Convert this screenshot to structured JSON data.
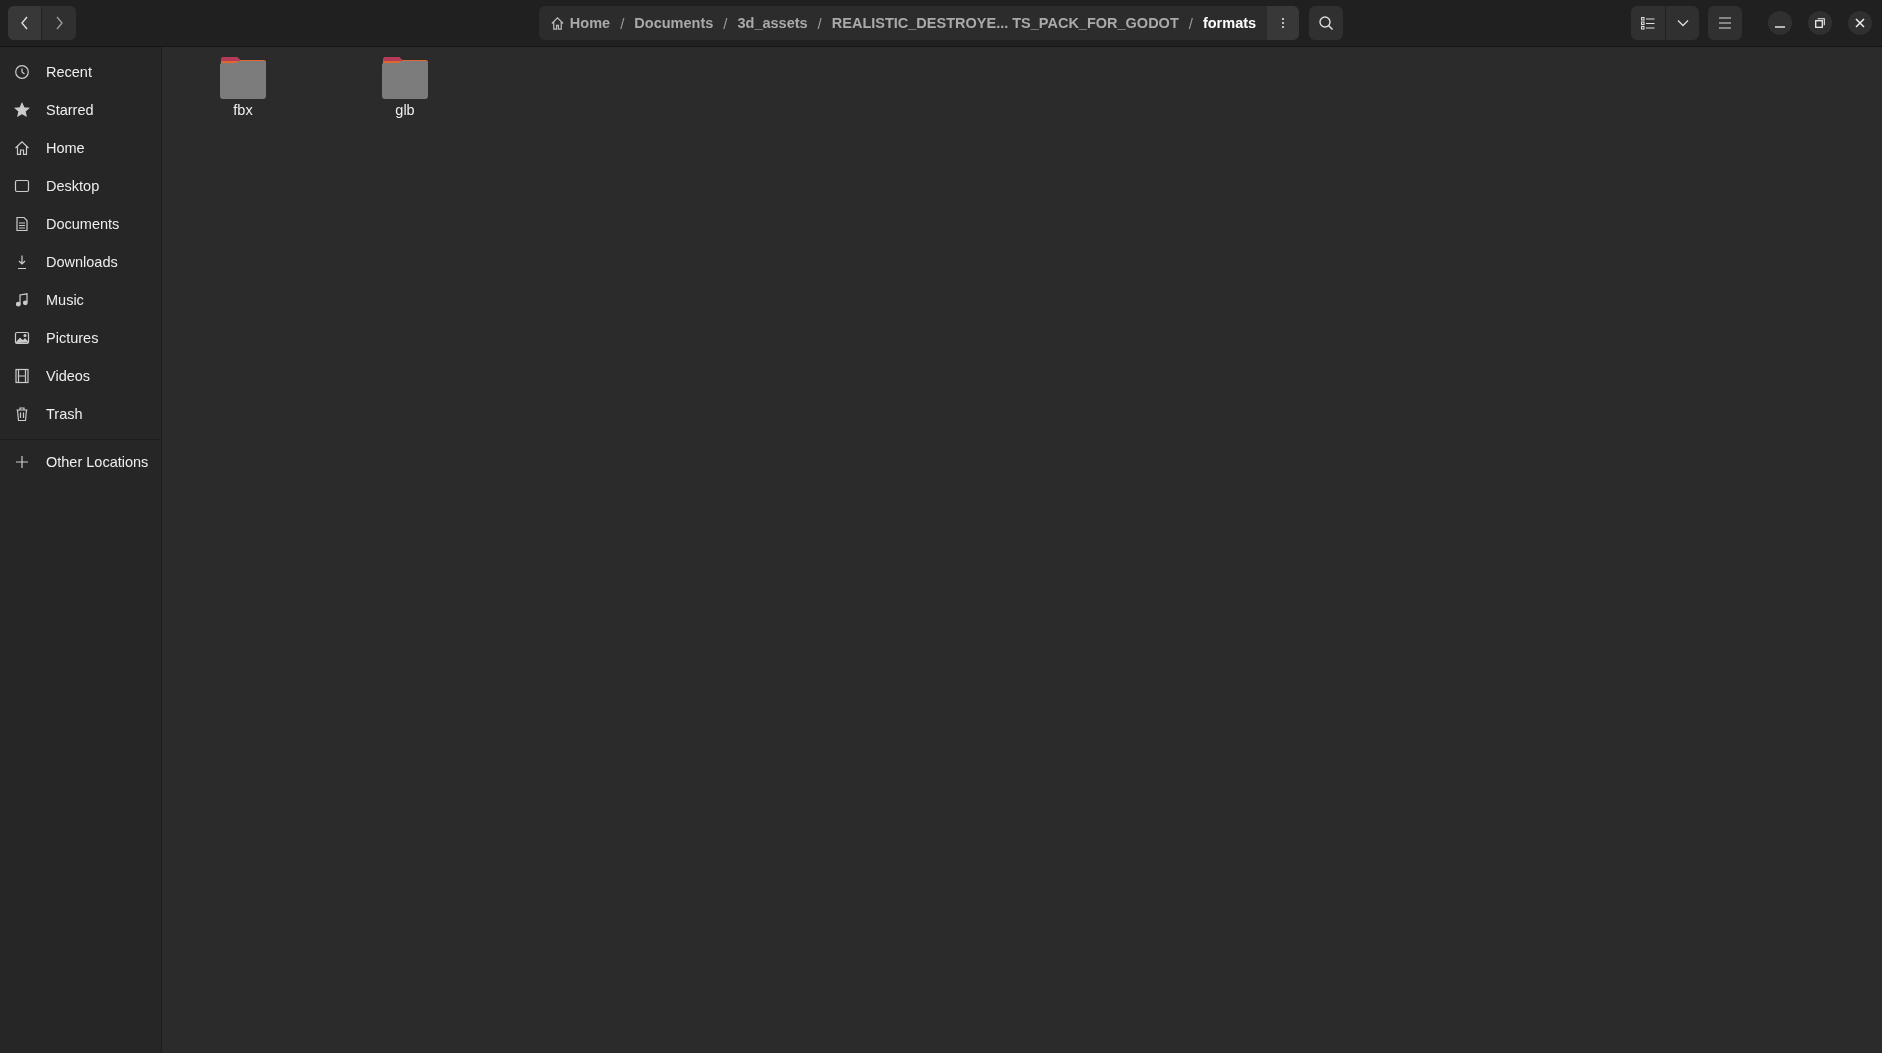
{
  "breadcrumbs": [
    {
      "label": "Home",
      "selected": false
    },
    {
      "label": "Documents",
      "selected": false
    },
    {
      "label": "3d_assets",
      "selected": false
    },
    {
      "label": "REALISTIC_DESTROYE... TS_PACK_FOR_GODOT",
      "selected": false
    },
    {
      "label": "formats",
      "selected": true
    }
  ],
  "separators": [
    "/",
    "/",
    "/",
    "/"
  ],
  "sidebar": {
    "items": [
      {
        "label": "Recent",
        "selected": false
      },
      {
        "label": "Starred",
        "selected": false
      },
      {
        "label": "Home",
        "selected": false
      },
      {
        "label": "Desktop",
        "selected": false
      },
      {
        "label": "Documents",
        "selected": false
      },
      {
        "label": "Downloads",
        "selected": false
      },
      {
        "label": "Music",
        "selected": false
      },
      {
        "label": "Pictures",
        "selected": false
      },
      {
        "label": "Videos",
        "selected": false
      },
      {
        "label": "Trash",
        "selected": false
      }
    ],
    "other": {
      "label": "Other Locations"
    }
  },
  "files": [
    {
      "name": "fbx"
    },
    {
      "name": "glb"
    }
  ]
}
